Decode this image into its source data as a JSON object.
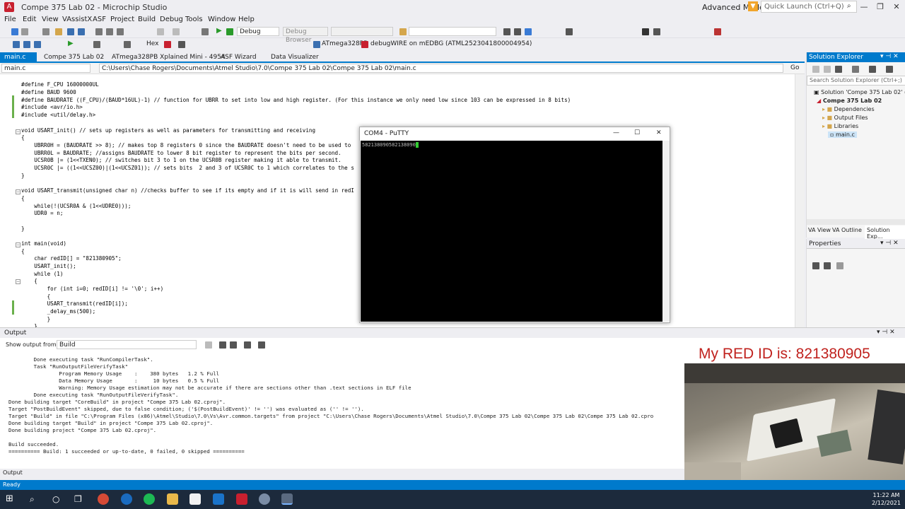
{
  "window": {
    "title": "Compe 375 Lab 02 - Microchip Studio",
    "mode": "Advanced Mode",
    "quick_launch_placeholder": "Quick Launch (Ctrl+Q)"
  },
  "menu": [
    "File",
    "Edit",
    "View",
    "VAssistX",
    "ASF",
    "Project",
    "Build",
    "Debug",
    "Tools",
    "Window",
    "Help"
  ],
  "toolbar": {
    "config": "Debug",
    "debug_browser": "Debug Browser",
    "hex": "Hex",
    "device": "ATmega328PB",
    "tool": "debugWIRE on mEDBG (ATML2523041800004954)"
  },
  "doc_tabs": [
    "main.c",
    "Compe 375 Lab 02",
    "ATmega328PB Xplained Mini - 4954",
    "ASF Wizard",
    "Data Visualizer"
  ],
  "nav": {
    "file": "main.c",
    "path": "C:\\Users\\Chase Rogers\\Documents\\Atmel Studio\\7.0\\Compe 375 Lab 02\\Compe 375 Lab 02\\main.c",
    "go": "Go"
  },
  "code": [
    "#define F_CPU 16000000UL",
    "#define BAUD 9600",
    "#define BAUDRATE ((F_CPU)/(BAUD*16UL)-1) // function for UBRR to set into low and high register. (For this instance we only need low since 103 can be expressed in 8 bits)",
    "#include <avr/io.h>",
    "#include <util/delay.h>",
    "",
    "void USART_init() // sets up registers as well as parameters for transmitting and receiving",
    "{",
    "    UBRR0H = (BAUDRATE >> 8); // makes top 8 registers 0 since the BAUDRATE doesn't need to be used to",
    "    UBRR0L = BAUDRATE; //assigns BAUDRATE to lower 8 bit register to represent the bits per second.",
    "    UCSR0B |= (1<<TXEN0); // switches bit 3 to 1 on the UCSR0B register making it able to transmit.",
    "    UCSR0C |= ((1<<UCSZ00)|(1<<UCSZ01)); // sets bits  2 and 3 of UCSR0C to 1 which correlates to the s",
    "}",
    "",
    "void USART_transmit(unsigned char n) //checks buffer to see if its empty and if it is will send in redI",
    "{",
    "    while(!(UCSR0A & (1<<UDRE0)));",
    "    UDR0 = n;",
    "",
    "}",
    "",
    "int main(void)",
    "{",
    "    char redID[] = \"821380905\";",
    "    USART_init();",
    "    while (1)",
    "    {",
    "        for (int i=0; redID[i] != '\\0'; i++)",
    "        {",
    "        USART_transmit(redID[i]);",
    "        _delay_ms(500);",
    "        }",
    "    }"
  ],
  "putty": {
    "title": "COM4 - PuTTY",
    "terminal_text": "582138090582138090"
  },
  "solution_explorer": {
    "title": "Solution Explorer",
    "search_placeholder": "Search Solution Explorer (Ctrl+;)",
    "items": [
      "Solution 'Compe 375 Lab 02' (1 p",
      "Compe 375 Lab 02",
      "Dependencies",
      "Output Files",
      "Libraries",
      "main.c"
    ],
    "bottom_tabs": [
      "VA View",
      "VA Outline",
      "Solution Exp..."
    ]
  },
  "properties": {
    "title": "Properties"
  },
  "output": {
    "title": "Output",
    "show_from_label": "Show output from:",
    "show_from_value": "Build",
    "lines": [
      "        Done executing task \"RunCompilerTask\".",
      "        Task \"RunOutputFileVerifyTask\"",
      "                Program Memory Usage    :    380 bytes   1.2 % Full",
      "                Data Memory Usage       :     10 bytes   0.5 % Full",
      "                Warning: Memory Usage estimation may not be accurate if there are sections other than .text sections in ELF file",
      "        Done executing task \"RunOutputFileVerifyTask\".",
      "Done building target \"CoreBuild\" in project \"Compe 375 Lab 02.cproj\".",
      "Target \"PostBuildEvent\" skipped, due to false condition; ('$(PostBuildEvent)' != '') was evaluated as ('' != '').",
      "Target \"Build\" in file \"C:\\Program Files (x86)\\Atmel\\Studio\\7.0\\Vs\\Avr.common.targets\" from project \"C:\\Users\\Chase Rogers\\Documents\\Atmel Studio\\7.0\\Compe 375 Lab 02\\Compe 375 Lab 02\\Compe 375 Lab 02.cpro",
      "Done building target \"Build\" in project \"Compe 375 Lab 02.cproj\".",
      "Done building project \"Compe 375 Lab 02.cproj\".",
      "",
      "Build succeeded.",
      "========== Build: 1 succeeded or up-to-date, 0 failed, 0 skipped =========="
    ],
    "footer_tab": "Output"
  },
  "overlay": {
    "red_id": "My RED ID is: 821380905"
  },
  "status": {
    "text": "Ready"
  },
  "taskbar": {
    "time": "11:22 AM",
    "date": "2/12/2021"
  },
  "colors": {
    "accent": "#007acc",
    "taskbar": "#1c2a3c",
    "redid": "#c0221e"
  }
}
